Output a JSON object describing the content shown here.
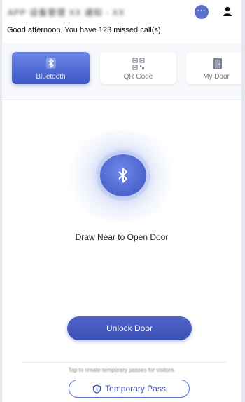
{
  "header": {
    "title": "APP 设备管理 XX 通知 - XX",
    "greeting": "Good afternoon. You have 123 missed call(s)."
  },
  "icons": {
    "message": "message-icon",
    "profile": "profile-icon",
    "bluetooth": "bluetooth-icon",
    "qr_code": "qr-code-icon",
    "door": "door-icon",
    "pass": "pass-icon"
  },
  "tabs": [
    {
      "label": "Bluetooth",
      "active": true
    },
    {
      "label": "QR Code",
      "active": false
    },
    {
      "label": "My Door",
      "active": false
    }
  ],
  "main": {
    "prompt": "Draw Near to Open Door",
    "unlock_label": "Unlock Door",
    "hint": "Tap to create temporary passes for visitors.",
    "temporary_pass_label": "Temporary Pass"
  },
  "colors": {
    "accent": "#3d57c8",
    "button": "#4456bd"
  }
}
